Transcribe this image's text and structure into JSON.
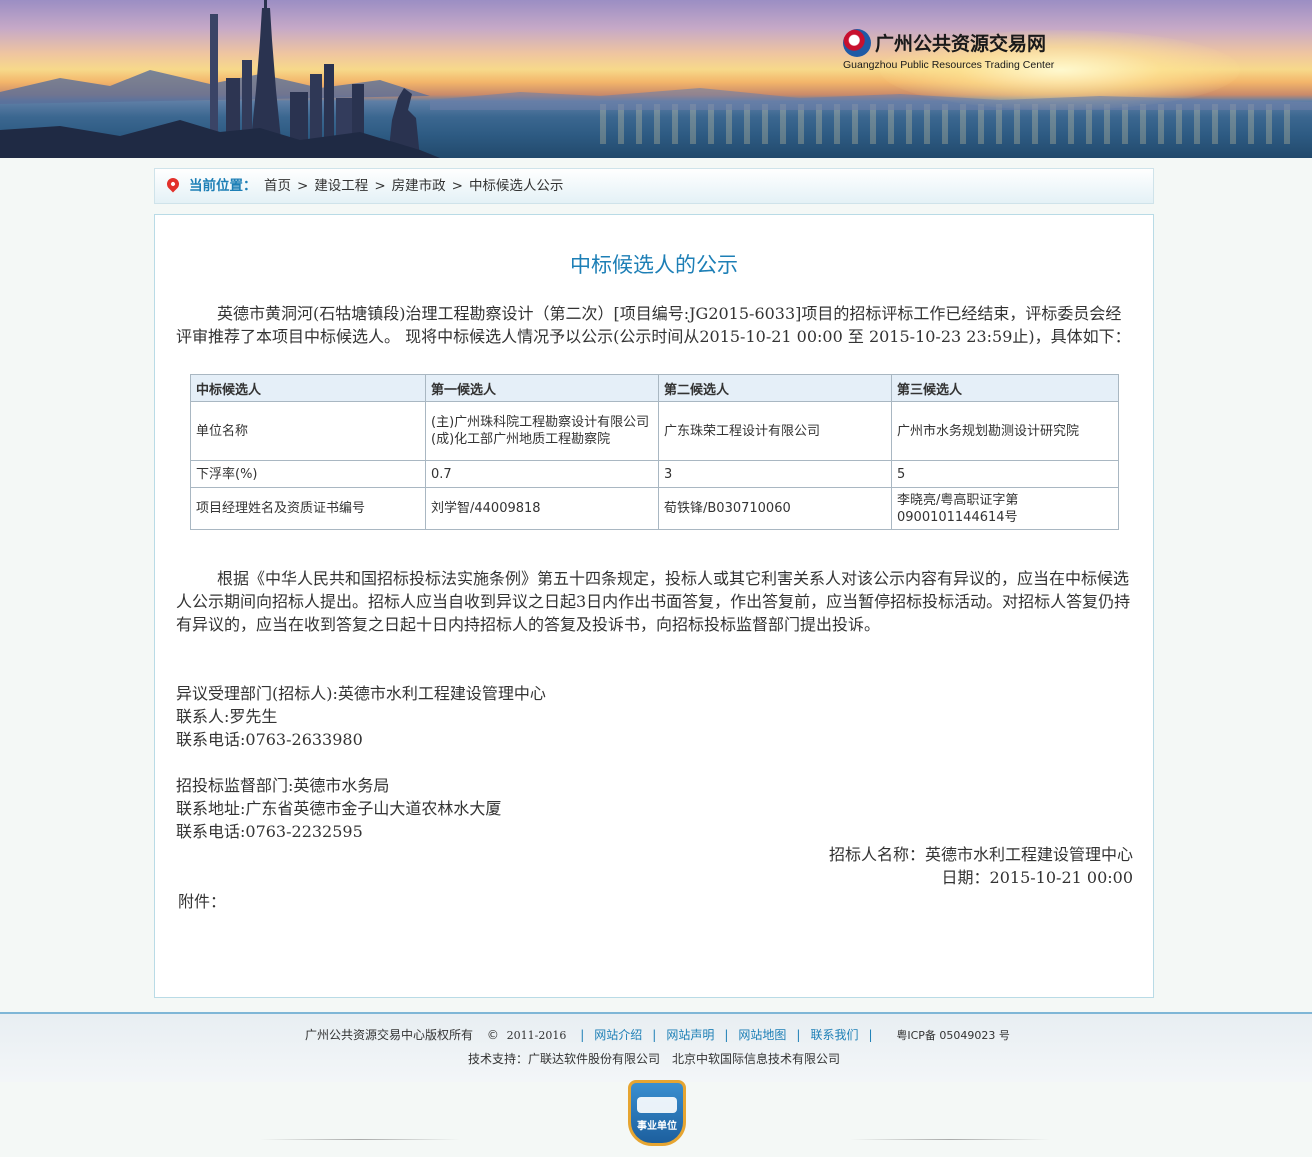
{
  "header": {
    "logo_cn": "广州公共资源交易网",
    "logo_en": "Guangzhou Public Resources Trading Center"
  },
  "breadcrumb": {
    "label": "当前位置：",
    "items": [
      "首页",
      "建设工程",
      "房建市政",
      "中标候选人公示"
    ],
    "separator": ">"
  },
  "notice": {
    "title": "中标候选人的公示",
    "intro": "英德市黄洞河(石牯塘镇段)治理工程勘察设计（第二次）[项目编号:JG2015-6033]项目的招标评标工作已经结束，评标委员会经评审推荐了本项目中标候选人。 现将中标候选人情况予以公示(公示时间从2015-10-21 00:00 至 2015-10-23 23:59止)，具体如下：",
    "table": {
      "headers": [
        "中标候选人",
        "第一候选人",
        "第二候选人",
        "第三候选人"
      ],
      "rows": [
        [
          "单位名称",
          "(主)广州珠科院工程勘察设计有限公司(成)化工部广州地质工程勘察院",
          "广东珠荣工程设计有限公司",
          "广州市水务规划勘测设计研究院"
        ],
        [
          "下浮率(%)",
          "0.7",
          "3",
          "5"
        ],
        [
          "项目经理姓名及资质证书编号",
          "刘学智/44009818",
          "荀铁锋/B030710060",
          "李晓亮/粤高职证字第0900101144614号"
        ]
      ]
    },
    "rule_text": "根据《中华人民共和国招标投标法实施条例》第五十四条规定，投标人或其它利害关系人对该公示内容有异议的，应当在中标候选人公示期间向招标人提出。招标人应当自收到异议之日起3日内作出书面答复，作出答复前，应当暂停招标投标活动。对招标人答复仍持有异议的，应当在收到答复之日起十日内持招标人的答复及投诉书，向招标投标监督部门提出投诉。",
    "objection_dept": "异议受理部门(招标人):英德市水利工程建设管理中心",
    "objection_contact": "联系人:罗先生",
    "objection_phone": "联系电话:0763-2633980",
    "supervision_dept": "招投标监督部门:英德市水务局",
    "supervision_address": "联系地址:广东省英德市金子山大道农林水大厦",
    "supervision_phone": "联系电话:0763-2232595",
    "tenderer_name": "招标人名称：英德市水利工程建设管理中心",
    "date": "日期：2015-10-21 00:00",
    "attachment": "附件："
  },
  "footer": {
    "copyright": "广州公共资源交易中心版权所有",
    "copyright_symbol": "©",
    "years": "2011-2016",
    "links": [
      "网站介绍",
      "网站声明",
      "网站地图",
      "联系我们"
    ],
    "icp": "粤ICP备 05049023 号",
    "support": "技术支持：广联达软件股份有限公司　北京中软国际信息技术有限公司",
    "badge_text": "事业单位"
  }
}
